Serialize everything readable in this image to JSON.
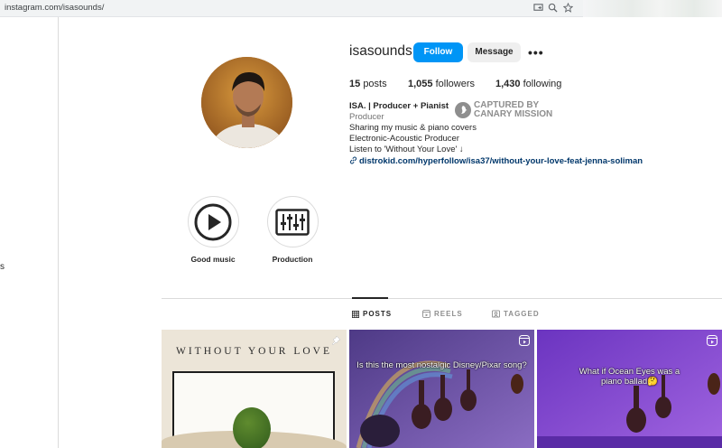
{
  "browser": {
    "url": "instagram.com/isasounds/"
  },
  "sidebar": {
    "fragment": "s"
  },
  "profile": {
    "username": "isasounds",
    "follow_label": "Follow",
    "message_label": "Message",
    "more_label": "•••",
    "stats": {
      "posts_count": "15",
      "posts_label": "posts",
      "followers_count": "1,055",
      "followers_label": "followers",
      "following_count": "1,430",
      "following_label": "following"
    },
    "bio": {
      "name": "ISA. | Producer + Pianist",
      "category": "Producer",
      "lines": [
        "Sharing my music & piano covers",
        "Electronic-Acoustic Producer",
        "Listen to 'Without Your Love' ↓"
      ],
      "link": "distrokid.com/hyperfollow/isa37/without-your-love-feat-jenna-soliman"
    },
    "badge": {
      "line1": "CAPTURED BY",
      "line2": "CANARY MISSION"
    }
  },
  "highlights": [
    {
      "label": "Good music",
      "icon": "play-icon"
    },
    {
      "label": "Production",
      "icon": "sliders-icon"
    }
  ],
  "tabs": [
    {
      "label": "POSTS",
      "icon": "grid-icon",
      "active": true
    },
    {
      "label": "REELS",
      "icon": "reels-icon",
      "active": false
    },
    {
      "label": "TAGGED",
      "icon": "tagged-icon",
      "active": false
    }
  ],
  "posts": [
    {
      "title": "WITHOUT YOUR LOVE",
      "icon": "pin-icon"
    },
    {
      "caption": "Is this the most nostalgic Disney/Pixar song?",
      "icon": "reel-icon"
    },
    {
      "caption": "What if Ocean Eyes was a piano ballad🤔",
      "icon": "reel-icon"
    }
  ],
  "colors": {
    "accent": "#0095f6",
    "text": "#262626",
    "muted": "#737373",
    "link": "#00376b"
  }
}
